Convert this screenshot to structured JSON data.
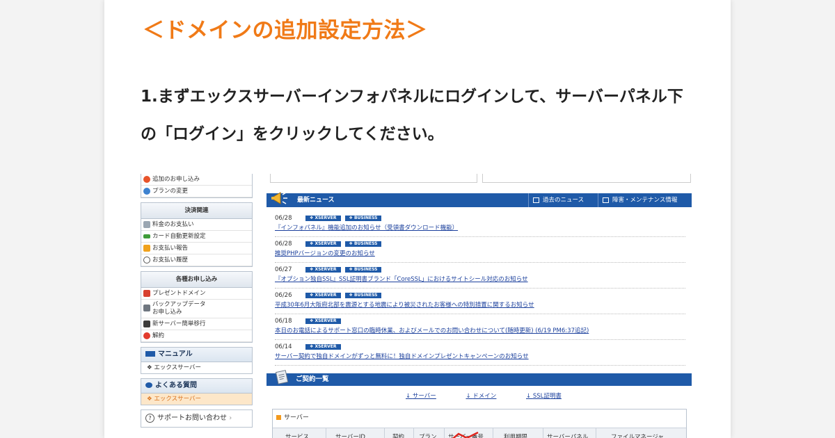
{
  "heading": "＜ドメインの追加設定方法＞",
  "step_text": "1.まずエックスサーバーインフォパネルにログインして、サーバーパネル下の「ログイン」をクリックしてください。",
  "sidebar": {
    "top_items": [
      "追加のお申し込み",
      "プランの変更"
    ],
    "payment": {
      "heading": "決済関連",
      "items": [
        "料金のお支払い",
        "カード自動更新設定",
        "お支払い報告",
        "お支払い履歴"
      ]
    },
    "applications": {
      "heading": "各種お申し込み",
      "items": [
        "プレゼントドメイン",
        "バックアップデータ\nお申し込み",
        "新サーバー簡単移行",
        "解約"
      ]
    },
    "manual": {
      "label": "マニュアル",
      "sub": "エックスサーバー"
    },
    "faq": {
      "label": "よくある質問",
      "sub": "エックスサーバー"
    },
    "support": "サポートお問い合わせ"
  },
  "news": {
    "title": "最新ニュース",
    "tab_past": "過去のニュース",
    "tab_maintenance": "障害・メンテナンス情報",
    "items": [
      {
        "date": "06/28",
        "badges": [
          "XSERVER",
          "BUSINESS"
        ],
        "text": "『インフォパネル』機能追加のお知らせ（受領書ダウンロード機能）"
      },
      {
        "date": "06/28",
        "badges": [
          "XSERVER",
          "BUSINESS"
        ],
        "text": "推奨PHPバージョンの変更のお知らせ"
      },
      {
        "date": "06/27",
        "badges": [
          "XSERVER",
          "BUSINESS"
        ],
        "text": "『オプション独自SSL』SSL証明書ブランド「CoreSSL」におけるサイトシール対応のお知らせ"
      },
      {
        "date": "06/26",
        "badges": [
          "XSERVER",
          "BUSINESS"
        ],
        "text": "平成30年6月大阪府北部を震源とする地震により被災されたお客様への特別措置に関するお知らせ"
      },
      {
        "date": "06/18",
        "badges": [
          "XSERVER"
        ],
        "text": "本日のお電話によるサポート窓口の臨時休業、およびメールでのお問い合わせについて(随時更新) (6/19 PM6:37追記)"
      },
      {
        "date": "06/14",
        "badges": [
          "XSERVER"
        ],
        "text": "サーバー契約で独自ドメインがずっと無料に！独自ドメインプレゼントキャンペーンのお知らせ"
      }
    ]
  },
  "contract": {
    "title": "ご契約一覧",
    "anchors": [
      "サーバー",
      "ドメイン",
      "SSL証明書"
    ],
    "server_heading": "サーバー",
    "columns": [
      "サービス",
      "サーバーID",
      "契約",
      "プラン",
      "サーバー番号",
      "利用期限",
      "サーバーパネル",
      "ファイルマネージャ"
    ]
  },
  "colors": {
    "heading": "#f07a17",
    "nav_blue": "#1f5aa8",
    "link": "#1a3f9c",
    "highlight": "#fde7c9"
  }
}
